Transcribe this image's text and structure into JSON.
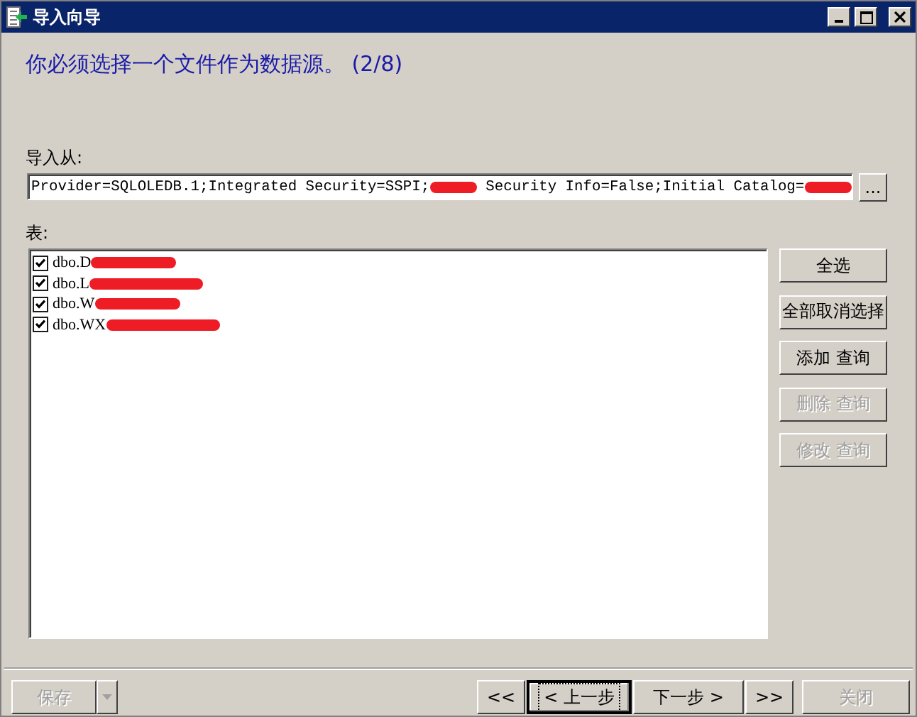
{
  "window": {
    "title": "导入向导"
  },
  "heading": "你必须选择一个文件作为数据源。 (2/8)",
  "source": {
    "label": "导入从:",
    "segments": [
      {
        "kind": "text",
        "text": "Provider=SQLOLEDB.1;Integrated Security=SSPI;"
      },
      {
        "kind": "redacted"
      },
      {
        "kind": "text",
        "text": " Security Info=False;Initial Catalog="
      },
      {
        "kind": "redacted"
      }
    ],
    "browse_button": "..."
  },
  "tables": {
    "label": "表:",
    "items": [
      {
        "text": "dbo.D",
        "checked": true,
        "redacted": true
      },
      {
        "text": "dbo.L",
        "checked": true,
        "redacted": true
      },
      {
        "text": "dbo.W",
        "checked": true,
        "redacted": true
      },
      {
        "text": "dbo.WX",
        "checked": true,
        "redacted": true
      }
    ]
  },
  "side_buttons": [
    {
      "label": "全选",
      "disabled": false
    },
    {
      "label": "全部取消选择",
      "disabled": false
    },
    {
      "label": "添加 查询",
      "disabled": false
    },
    {
      "label": "删除 查询",
      "disabled": true
    },
    {
      "label": "修改 查询",
      "disabled": true
    }
  ],
  "footer": {
    "save": {
      "label": "保存",
      "disabled": true
    },
    "nav": [
      {
        "label": "<<",
        "disabled": false,
        "focused": false
      },
      {
        "label": "< 上一步",
        "disabled": false,
        "focused": true
      },
      {
        "label": "下一步 >",
        "disabled": false,
        "focused": false
      },
      {
        "label": ">>",
        "disabled": false,
        "focused": false
      },
      {
        "label": "关闭",
        "disabled": true,
        "focused": false
      }
    ]
  }
}
